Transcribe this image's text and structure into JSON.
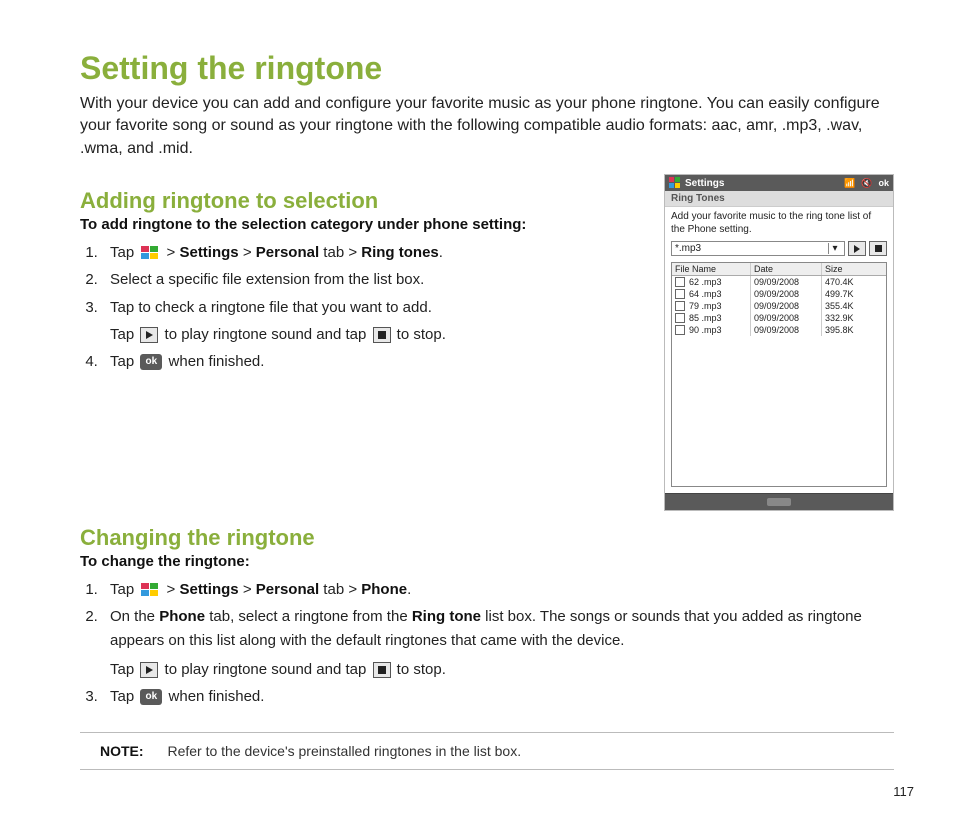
{
  "title": "Setting the ringtone",
  "intro": "With your device you can add and configure your favorite music as your phone ringtone. You can easily configure your favorite song or sound as your ringtone with the following compatible audio formats: aac, amr, .mp3, .wav, .wma, and .mid.",
  "section1": {
    "heading": "Adding ringtone to selection",
    "subhead": "To add ringtone to the selection category under phone setting:",
    "step1_a": "Tap ",
    "step1_b": " > ",
    "step1_settings": "Settings",
    "step1_c": " > ",
    "step1_personal": "Personal",
    "step1_d": " tab > ",
    "step1_ringtones": "Ring tones",
    "step1_e": ".",
    "step2": "Select a specific file extension from the list box.",
    "step3": "Tap to check a ringtone file that you want to add.",
    "step3b_a": "Tap ",
    "step3b_b": " to play ringtone sound and tap ",
    "step3b_c": " to stop.",
    "step4_a": "Tap ",
    "step4_b": " when finished."
  },
  "section2": {
    "heading": "Changing the ringtone",
    "subhead": "To change the ringtone:",
    "step1_a": "Tap ",
    "step1_b": " > ",
    "step1_settings": "Settings",
    "step1_c": " > ",
    "step1_personal": "Personal",
    "step1_d": " tab > ",
    "step1_phone": "Phone",
    "step1_e": ".",
    "step2_a": "On the ",
    "step2_phone": "Phone",
    "step2_b": " tab, select a ringtone from the ",
    "step2_ringtone": "Ring tone",
    "step2_c": " list box. The songs or sounds that you added as ringtone appears on this list along with the default ringtones that came with the device.",
    "step2d_a": "Tap ",
    "step2d_b": " to play ringtone sound and tap ",
    "step2d_c": " to stop.",
    "step3_a": "Tap ",
    "step3_b": " when finished."
  },
  "note_label": "NOTE:",
  "note_text": "Refer to the device's preinstalled ringtones in the list box.",
  "page_number": "117",
  "ok_label": "ok",
  "screenshot": {
    "titlebar": "Settings",
    "ok": "ok",
    "subbar": "Ring Tones",
    "desc": "Add your favorite music to the ring tone list of the Phone setting.",
    "select_value": "*.mp3",
    "columns": {
      "name": "File Name",
      "date": "Date",
      "size": "Size"
    },
    "rows": [
      {
        "name": "62 .mp3",
        "date": "09/09/2008",
        "size": "470.4K"
      },
      {
        "name": "64 .mp3",
        "date": "09/09/2008",
        "size": "499.7K"
      },
      {
        "name": "79 .mp3",
        "date": "09/09/2008",
        "size": "355.4K"
      },
      {
        "name": "85 .mp3",
        "date": "09/09/2008",
        "size": "332.9K"
      },
      {
        "name": "90 .mp3",
        "date": "09/09/2008",
        "size": "395.8K"
      }
    ]
  }
}
